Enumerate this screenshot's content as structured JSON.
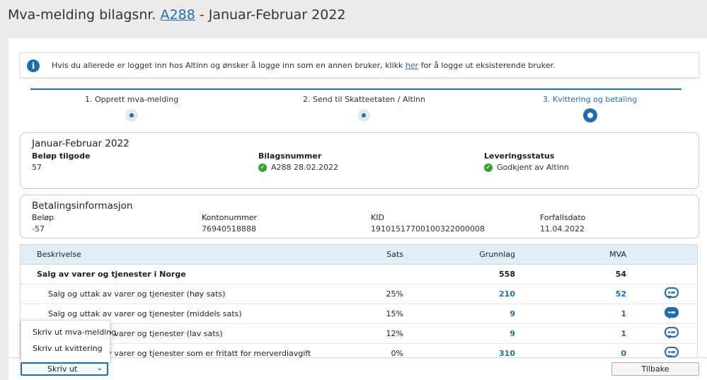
{
  "header": {
    "title_prefix": "Mva-melding bilagsnr.",
    "doc_link": "A288",
    "title_suffix": "- Januar-Februar 2022"
  },
  "info": {
    "text_before": "Hvis du allerede er logget inn hos Altinn og ønsker å logge inn som en annen bruker, klikk",
    "link": "her",
    "text_after": "for å logge ut eksisterende bruker."
  },
  "steps": [
    {
      "label": "1. Opprett mva-melding"
    },
    {
      "label": "2. Send til Skatteetaten / Altinn"
    },
    {
      "label": "3. Kvittering og betaling"
    }
  ],
  "summary": {
    "title": "Januar-Februar 2022",
    "belop_label": "Beløp tilgode",
    "belop_value": "57",
    "bilag_label": "Bilagsnummer",
    "bilag_value": "A288 28.02.2022",
    "status_label": "Leveringsstatus",
    "status_value": "Godkjent av Altinn"
  },
  "payment": {
    "title": "Betalingsinformasjon",
    "belop_label": "Beløp",
    "belop_value": "-57",
    "konto_label": "Kontonummer",
    "konto_value": "76940518888",
    "kid_label": "KID",
    "kid_value": "19101517700100322000008",
    "forfall_label": "Forfallsdato",
    "forfall_value": "11.04.2022"
  },
  "table": {
    "headers": {
      "desc": "Beskrivelse",
      "sats": "Sats",
      "grunnlag": "Grunnlag",
      "mva": "MVA"
    },
    "rows": [
      {
        "desc": "Salg av varer og tjenester i Norge",
        "sats": "",
        "grunnlag": "558",
        "mva": "54"
      },
      {
        "desc": "Salg og uttak av varer og tjenester (høy sats)",
        "sats": "25%",
        "grunnlag": "210",
        "mva": "52"
      },
      {
        "desc": "Salg og uttak av varer og tjenester (middels sats)",
        "sats": "15%",
        "grunnlag": "9",
        "mva": "1"
      },
      {
        "desc": "Salg og uttak av varer og tjenester (lav sats)",
        "sats": "12%",
        "grunnlag": "9",
        "mva": "1"
      },
      {
        "desc": "Salg og uttak av varer og tjenester som er fritatt for merverdiavgift",
        "sats": "0%",
        "grunnlag": "310",
        "mva": "0"
      }
    ]
  },
  "print_menu": {
    "items": [
      "Skriv ut mva-melding",
      "Skriv ut kvittering"
    ],
    "button_label": "Skriv ut"
  },
  "back_button": "Tilbake",
  "colors": {
    "accent": "#1f6fb0",
    "success": "#3aa23a",
    "table_header": "#dfeef8"
  }
}
